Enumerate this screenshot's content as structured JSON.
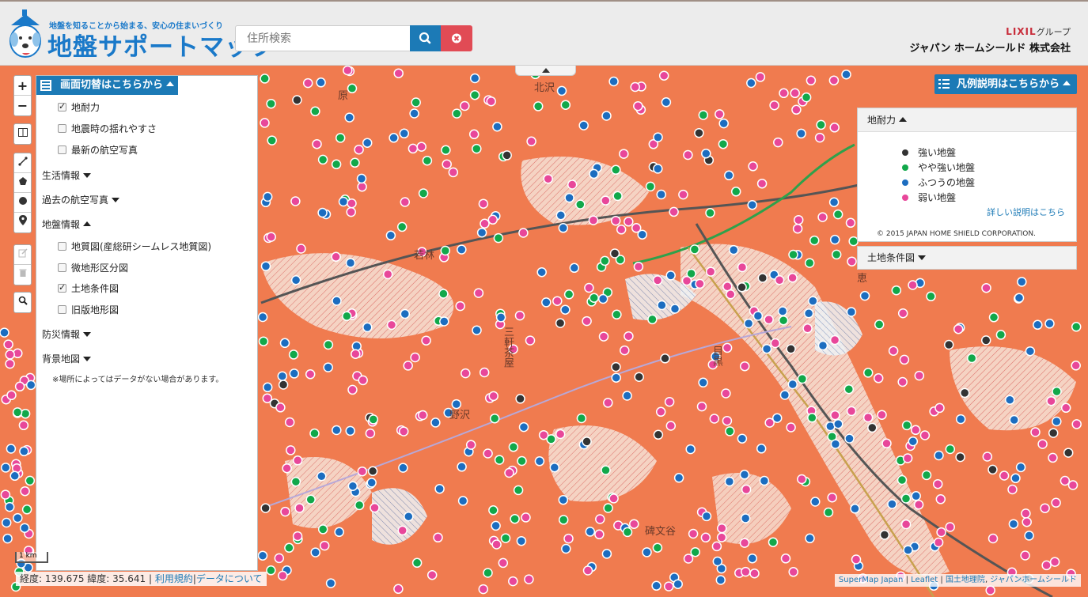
{
  "header": {
    "tagline": "地盤を知ることから始まる、安心の住まいづくり",
    "title": "地盤サポートマップ",
    "search_placeholder": "住所検索",
    "brand_lixil": "LIXIL",
    "brand_group": "グループ",
    "brand_name": "ジャパン ホームシールド 株式会社"
  },
  "left_panel": {
    "header": "画面切替はこちらから",
    "top_layers": [
      {
        "label": "地耐力",
        "checked": true
      },
      {
        "label": "地震時の揺れやすさ",
        "checked": false
      },
      {
        "label": "最新の航空写真",
        "checked": false
      }
    ],
    "sections": {
      "life": "生活情報",
      "past_photo": "過去の航空写真",
      "ground": "地盤情報",
      "disaster": "防災情報",
      "background": "背景地図"
    },
    "ground_layers": [
      {
        "label": "地質図(産総研シームレス地質図)",
        "checked": false
      },
      {
        "label": "微地形区分図",
        "checked": false
      },
      {
        "label": "土地条件図",
        "checked": true
      },
      {
        "label": "旧版地形図",
        "checked": false
      }
    ],
    "note": "※場所によってはデータがない場合があります。"
  },
  "legend": {
    "button": "凡例説明はこちらから",
    "header": "地耐力",
    "items": [
      {
        "label": "強い地盤",
        "color": "#333333"
      },
      {
        "label": "やや強い地盤",
        "color": "#11a84a"
      },
      {
        "label": "ふつうの地盤",
        "color": "#1c6dc0"
      },
      {
        "label": "弱い地盤",
        "color": "#e8479a"
      }
    ],
    "link": "詳しい説明はこちら",
    "copyright": "© 2015 JAPAN HOME SHIELD CORPORATION.",
    "land_header": "土地条件図"
  },
  "map_labels": {
    "l1": "若林",
    "l2": "野沢",
    "l3": "三軒茶屋",
    "l4": "目黒",
    "l5": "碑文谷",
    "l6": "原",
    "l7": "北沢",
    "l8": "恵"
  },
  "bottom": {
    "coord_text": "経度: 139.675 緯度: 35.641 |",
    "terms": "利用規約",
    "sep": "|",
    "data_link": "データについて",
    "scale": "1 km",
    "attr_supermap": "SuperMap Japan",
    "attr_leaflet": "Leaflet",
    "attr_gsi": "国土地理院",
    "attr_jhs": "ジャパンホームシールド"
  },
  "colors": {
    "primary": "#1c7ab6",
    "danger": "#e14b55",
    "map_base": "#f07b4f"
  }
}
